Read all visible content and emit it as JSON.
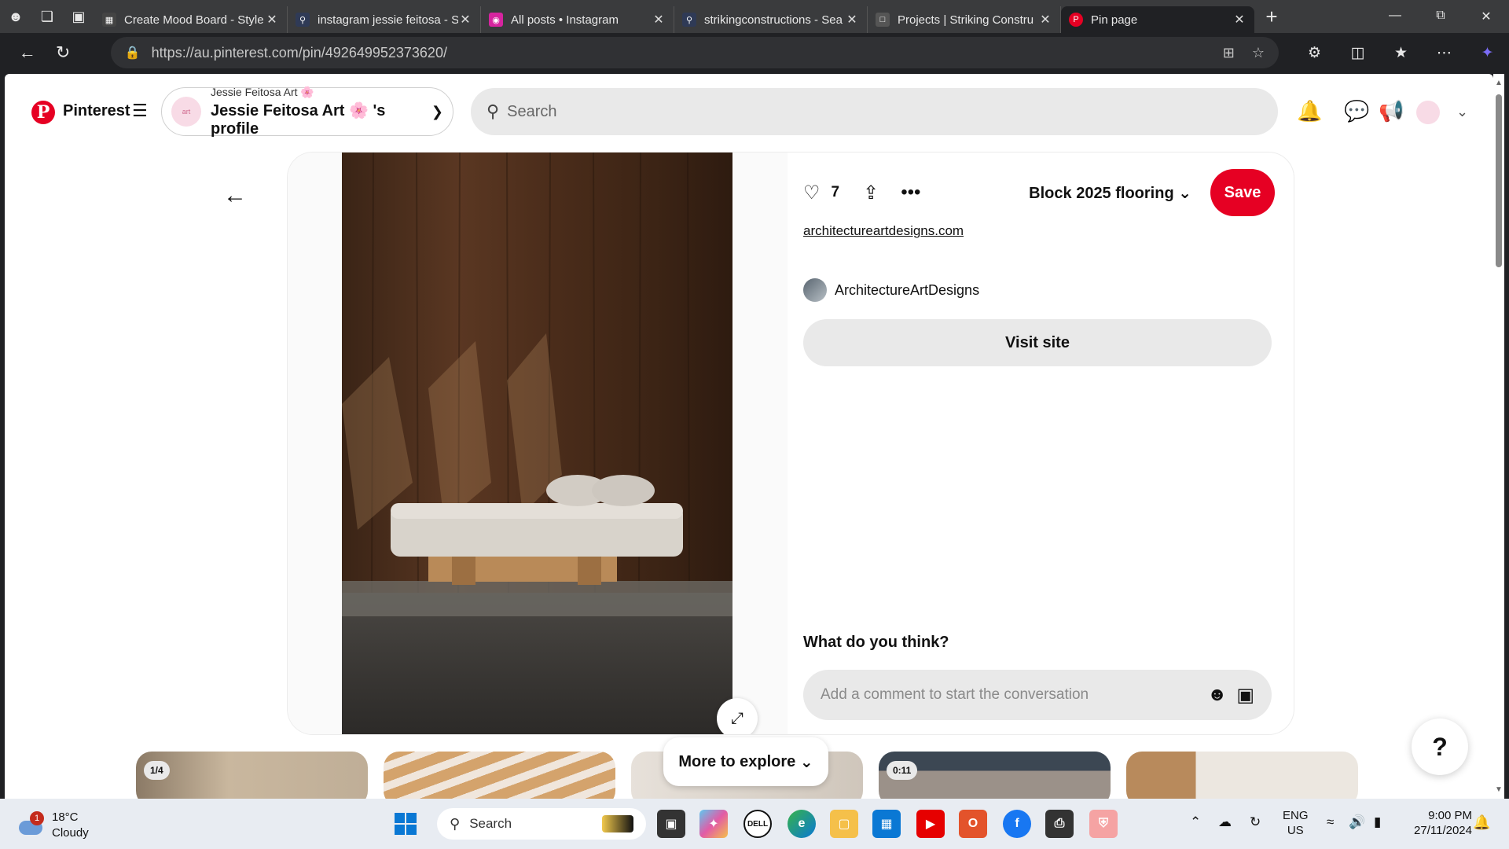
{
  "browser": {
    "tabs": [
      {
        "title": "Create Mood Board - Style",
        "favicon": "moodboard-icon",
        "color": "#444444"
      },
      {
        "title": "instagram jessie feitosa - S",
        "favicon": "search-icon",
        "color": "#2f3a56"
      },
      {
        "title": "All posts • Instagram",
        "favicon": "instagram-icon",
        "color": "#d6249f"
      },
      {
        "title": "strikingconstructions - Sea",
        "favicon": "search-icon",
        "color": "#2f3a56"
      },
      {
        "title": "Projects | Striking Constru",
        "favicon": "page-icon",
        "color": "#555555"
      },
      {
        "title": "Pin page",
        "favicon": "pinterest-icon",
        "color": "#e60023",
        "active": true
      }
    ],
    "url": "https://au.pinterest.com/pin/492649952373620/"
  },
  "header": {
    "brand": "Pinterest",
    "profile_small": "Jessie Feitosa Art 🌸",
    "profile_big": "Jessie Feitosa Art 🌸 's profile",
    "search_placeholder": "Search"
  },
  "pin": {
    "like_count": "7",
    "board_name": "Block 2025 flooring",
    "save_label": "Save",
    "source_link": "architectureartdesigns.com",
    "creator_name": "ArchitectureArtDesigns",
    "visit_label": "Visit site",
    "comments_heading": "What do you think?",
    "comment_placeholder": "Add a comment to start the conversation"
  },
  "explore": {
    "pill_label": "More to explore",
    "thumbs": [
      {
        "badge": "1/4"
      },
      {
        "badge": ""
      },
      {
        "badge": ""
      },
      {
        "badge": "0:11"
      },
      {
        "badge": ""
      }
    ]
  },
  "taskbar": {
    "temperature": "18°C",
    "condition": "Cloudy",
    "weather_badge": "1",
    "search_label": "Search",
    "lang_top": "ENG",
    "lang_bottom": "US",
    "time": "9:00 PM",
    "date": "27/11/2024"
  },
  "colors": {
    "pinterest_red": "#e60023",
    "chrome_dark": "#202124",
    "taskbar": "#e8ecf2"
  }
}
